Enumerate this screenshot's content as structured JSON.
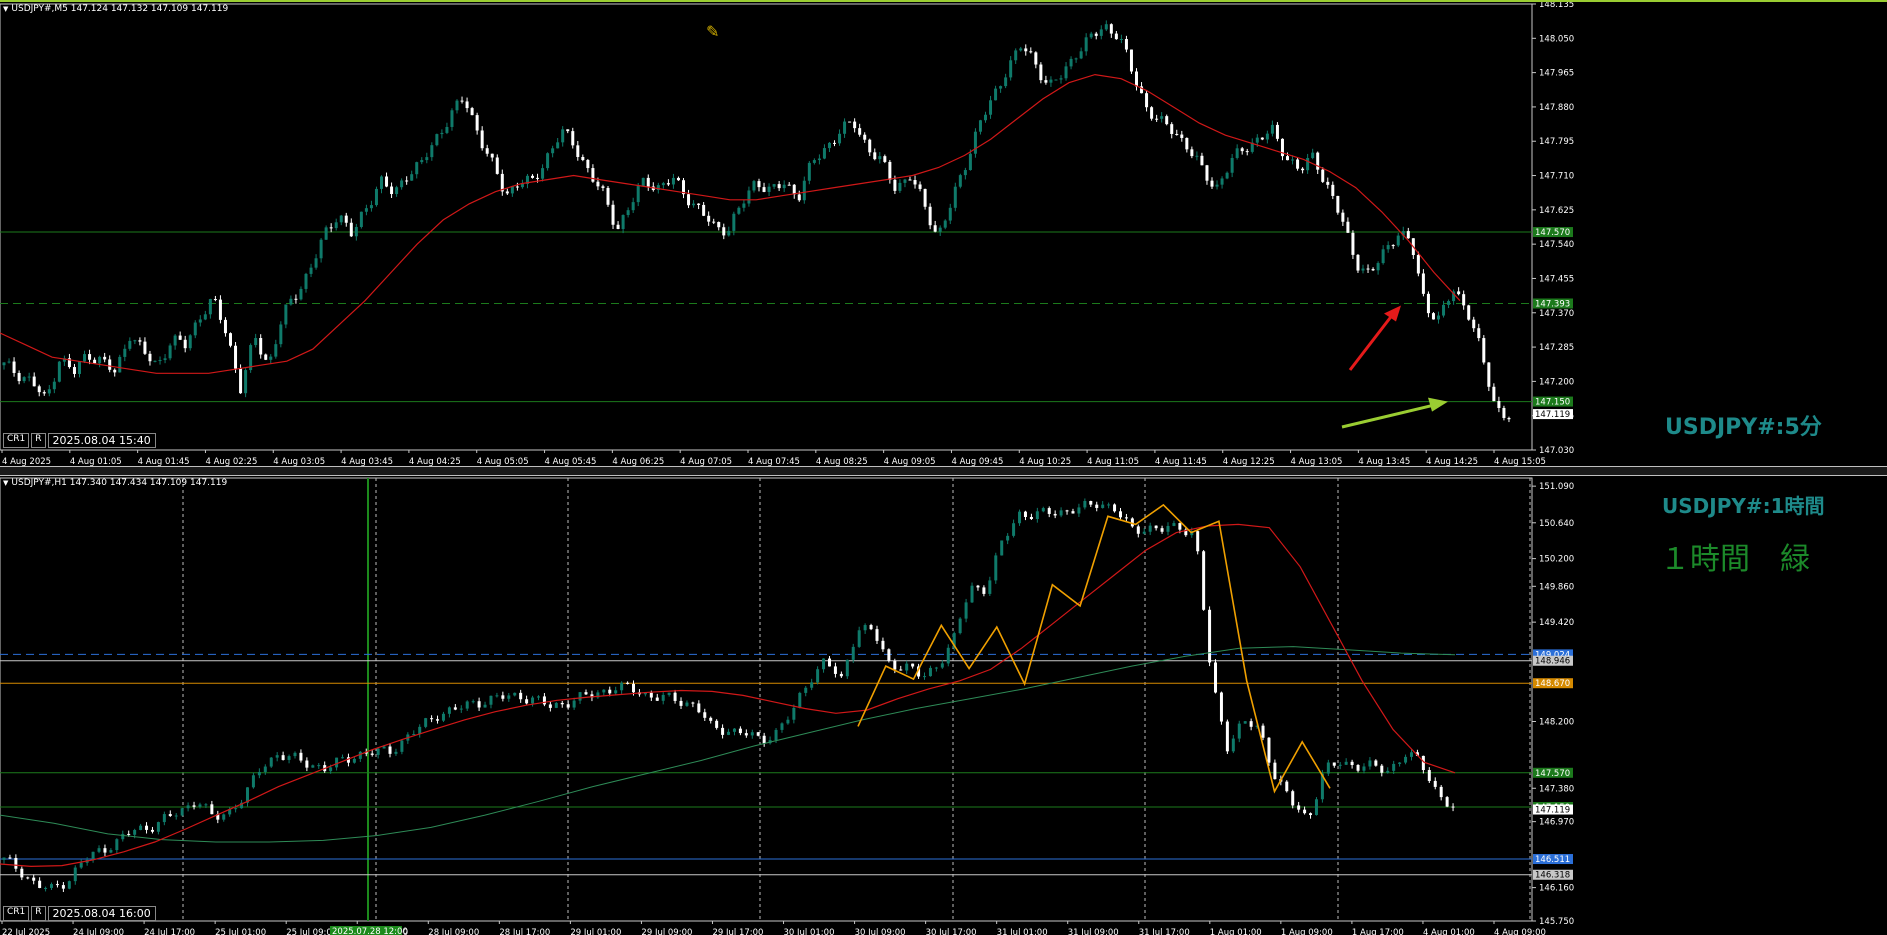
{
  "top_panel": {
    "header": "USDJPY#,M5  147.124 147.132 147.109 147.119",
    "label": "USDJPY#:5分",
    "mode_labels": [
      "CR1",
      "R"
    ],
    "cursor_time": "2025.08.04 15:40"
  },
  "bottom_panel": {
    "header": "USDJPY#,H1  147.340 147.434 147.109 147.119",
    "label": "USDJPY#:1時間",
    "note": "１時間　緑",
    "mode_labels": [
      "CR1",
      "R"
    ],
    "cursor_time": "2025.08.04 16:00",
    "highlight_time": "2025.07.28 12:00"
  },
  "colors": {
    "bull": "#0f7a6a",
    "bear": "#ffffff",
    "ma": "#d01818",
    "ma_slow": "#2e8b57",
    "zigzag": "#f0a000",
    "green_line": "#1c7a1c",
    "orange_line": "#d58a00",
    "blue_line": "#2b6fd8",
    "label_text": "#1e8a8a"
  },
  "chart_data": [
    {
      "type": "candlestick",
      "symbol": "USDJPY#",
      "timeframe": "M5",
      "ylim": [
        147.03,
        148.135
      ],
      "y_ticks": [
        148.135,
        148.05,
        147.965,
        147.88,
        147.795,
        147.71,
        147.625,
        147.54,
        147.455,
        147.37,
        147.285,
        147.2,
        147.115,
        147.03
      ],
      "x_ticks": [
        "4 Aug 2025",
        "4 Aug 01:05",
        "4 Aug 01:45",
        "4 Aug 02:25",
        "4 Aug 03:05",
        "4 Aug 03:45",
        "4 Aug 04:25",
        "4 Aug 05:05",
        "4 Aug 05:45",
        "4 Aug 06:25",
        "4 Aug 07:05",
        "4 Aug 07:45",
        "4 Aug 08:25",
        "4 Aug 09:05",
        "4 Aug 09:45",
        "4 Aug 10:25",
        "4 Aug 11:05",
        "4 Aug 11:45",
        "4 Aug 12:25",
        "4 Aug 13:05",
        "4 Aug 13:45",
        "4 Aug 14:25",
        "4 Aug 15:05"
      ],
      "current_price": "147.119",
      "hlines": [
        {
          "price": 147.57,
          "label": "147.570",
          "style": "solid",
          "color": "green"
        },
        {
          "price": 147.393,
          "label": "147.393",
          "style": "dashed",
          "color": "green"
        },
        {
          "price": 147.15,
          "label": "147.150",
          "style": "solid",
          "color": "green"
        }
      ],
      "path": [
        147.24,
        147.22,
        147.2,
        147.15,
        147.26,
        147.22,
        147.27,
        147.25,
        147.22,
        147.32,
        147.27,
        147.24,
        147.3,
        147.29,
        147.36,
        147.4,
        147.32,
        147.18,
        147.31,
        147.24,
        147.36,
        147.42,
        147.48,
        147.56,
        147.62,
        147.56,
        147.63,
        147.7,
        147.66,
        147.72,
        147.74,
        147.8,
        147.86,
        147.9,
        147.82,
        147.74,
        147.66,
        147.7,
        147.69,
        147.76,
        147.82,
        147.78,
        147.72,
        147.66,
        147.58,
        147.64,
        147.7,
        147.68,
        147.7,
        147.66,
        147.62,
        147.58,
        147.58,
        147.64,
        147.7,
        147.67,
        147.69,
        147.66,
        147.74,
        147.78,
        147.82,
        147.84,
        147.78,
        147.74,
        147.68,
        147.71,
        147.64,
        147.56,
        147.64,
        147.74,
        147.84,
        147.9,
        147.98,
        148.03,
        147.99,
        147.93,
        147.96,
        148.02,
        148.05,
        148.08,
        148.06,
        147.96,
        147.88,
        147.84,
        147.82,
        147.78,
        147.72,
        147.68,
        147.74,
        147.78,
        147.8,
        147.82,
        147.76,
        147.72,
        147.76,
        147.68,
        147.6,
        147.5,
        147.46,
        147.52,
        147.57,
        147.54,
        147.39,
        147.35,
        147.43,
        147.38,
        147.27,
        147.14,
        147.11
      ],
      "ma": [
        147.32,
        147.29,
        147.26,
        147.25,
        147.24,
        147.23,
        147.22,
        147.22,
        147.22,
        147.23,
        147.24,
        147.25,
        147.28,
        147.34,
        147.4,
        147.47,
        147.54,
        147.6,
        147.64,
        147.67,
        147.69,
        147.7,
        147.71,
        147.7,
        147.69,
        147.68,
        147.67,
        147.66,
        147.65,
        147.65,
        147.66,
        147.67,
        147.68,
        147.69,
        147.7,
        147.71,
        147.73,
        147.76,
        147.8,
        147.85,
        147.9,
        147.94,
        147.96,
        147.95,
        147.92,
        147.88,
        147.84,
        147.81,
        147.79,
        147.77,
        147.75,
        147.72,
        147.68,
        147.62,
        147.55,
        147.47,
        147.4
      ],
      "annotations": [
        {
          "type": "arrow",
          "color": "red",
          "target": "dashed line 147.393"
        },
        {
          "type": "arrow",
          "color": "yellowgreen",
          "target": "line 147.150"
        }
      ]
    },
    {
      "type": "candlestick",
      "symbol": "USDJPY#",
      "timeframe": "H1",
      "ylim": [
        145.75,
        151.19
      ],
      "y_ticks": [
        151.09,
        150.64,
        150.2,
        149.86,
        149.42,
        148.2,
        147.38,
        146.97,
        146.16,
        145.75
      ],
      "x_ticks": [
        "22 Jul 2025",
        "24 Jul 09:00",
        "24 Jul 17:00",
        "25 Jul 01:00",
        "25 Jul 09:00",
        "28 Jul 01:00",
        "28 Jul 09:00",
        "28 Jul 17:00",
        "29 Jul 01:00",
        "29 Jul 09:00",
        "29 Jul 17:00",
        "30 Jul 01:00",
        "30 Jul 09:00",
        "30 Jul 17:00",
        "31 Jul 01:00",
        "31 Jul 09:00",
        "31 Jul 17:00",
        "1 Aug 01:00",
        "1 Aug 09:00",
        "1 Aug 17:00",
        "4 Aug 01:00",
        "4 Aug 09:00"
      ],
      "current_price": "147.119",
      "hlines": [
        {
          "price": 149.024,
          "label": "149.024",
          "style": "dashed",
          "color": "blue"
        },
        {
          "price": 148.946,
          "label": "148.946",
          "style": "solid",
          "color": "white"
        },
        {
          "price": 148.67,
          "label": "148.670",
          "style": "solid",
          "color": "orange"
        },
        {
          "price": 147.57,
          "label": "147.570",
          "style": "solid",
          "color": "green"
        },
        {
          "price": 147.15,
          "label": "147.150",
          "style": "solid",
          "color": "green"
        },
        {
          "price": 146.511,
          "label": "146.511",
          "style": "solid",
          "color": "blue"
        },
        {
          "price": 146.318,
          "label": "146.318",
          "style": "solid",
          "color": "white"
        }
      ],
      "path": [
        146.5,
        146.38,
        146.18,
        146.14,
        146.26,
        146.5,
        146.62,
        146.72,
        146.86,
        146.9,
        147.0,
        147.1,
        147.25,
        147.0,
        147.1,
        147.3,
        147.65,
        147.8,
        147.74,
        147.68,
        147.62,
        147.72,
        147.8,
        147.82,
        147.84,
        148.0,
        148.15,
        148.3,
        148.34,
        148.42,
        148.46,
        148.5,
        148.52,
        148.46,
        148.38,
        148.44,
        148.5,
        148.56,
        148.62,
        148.6,
        148.52,
        148.49,
        148.45,
        148.4,
        148.1,
        148.1,
        148.06,
        147.96,
        148.08,
        148.32,
        148.72,
        148.95,
        148.7,
        149.36,
        149.3,
        148.9,
        148.88,
        148.74,
        148.9,
        149.2,
        149.86,
        149.82,
        150.4,
        150.76,
        150.72,
        150.78,
        150.78,
        150.82,
        150.9,
        150.8,
        150.56,
        150.58,
        150.55,
        150.6,
        150.5,
        148.7,
        147.9,
        148.2,
        148.1,
        147.5,
        147.2,
        147.0,
        147.6,
        147.7,
        147.66,
        147.64,
        147.6,
        147.8,
        147.7,
        147.34,
        147.11
      ],
      "ma": [
        146.45,
        146.42,
        146.43,
        146.5,
        146.6,
        146.72,
        146.88,
        147.05,
        147.22,
        147.4,
        147.55,
        147.7,
        147.85,
        147.98,
        148.1,
        148.22,
        148.32,
        148.4,
        148.46,
        148.5,
        148.53,
        148.56,
        148.58,
        148.57,
        148.52,
        148.44,
        148.36,
        148.3,
        148.34,
        148.48,
        148.6,
        148.7,
        148.84,
        149.1,
        149.4,
        149.7,
        150.0,
        150.3,
        150.52,
        150.6,
        150.62,
        150.58,
        150.1,
        149.4,
        148.7,
        148.1,
        147.7,
        147.57
      ],
      "ma_slow": [
        147.05,
        146.95,
        146.82,
        146.75,
        146.72,
        146.72,
        146.74,
        146.8,
        146.9,
        147.05,
        147.22,
        147.4,
        147.56,
        147.72,
        147.9,
        148.06,
        148.22,
        148.36,
        148.48,
        148.6,
        148.74,
        148.88,
        149.0,
        149.1,
        149.12,
        149.08,
        149.04,
        149.02
      ],
      "zigzag": [
        {
          "x": 148.14
        },
        {
          "x": 148.88
        },
        {
          "x": 148.72
        },
        {
          "x": 149.38
        },
        {
          "x": 148.85
        },
        {
          "x": 149.36
        },
        {
          "x": 148.66
        },
        {
          "x": 149.88
        },
        {
          "x": 149.62
        },
        {
          "x": 150.72
        },
        {
          "x": 150.62
        },
        {
          "x": 150.86
        },
        {
          "x": 150.52
        },
        {
          "x": 150.66
        },
        {
          "x": 148.7
        },
        {
          "x": 147.34
        },
        {
          "x": 147.95
        },
        {
          "x": 147.38
        }
      ]
    }
  ]
}
